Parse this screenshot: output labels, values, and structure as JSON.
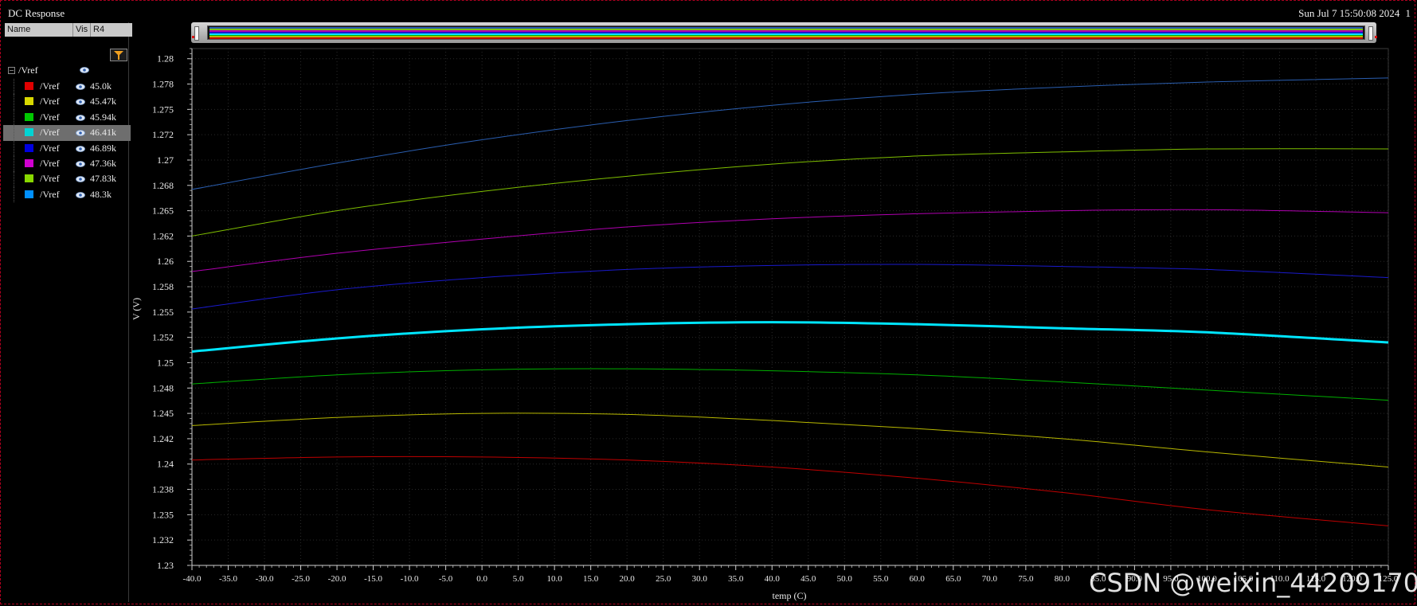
{
  "window": {
    "title": "DC Response",
    "timestamp": "Sun Jul 7 15:50:08 2024",
    "subwindow_index": "1"
  },
  "sidebar": {
    "columns": {
      "name": "Name",
      "vis": "Vis",
      "param": "R4"
    },
    "group": "/Vref",
    "icons": {
      "filter": "filter-icon",
      "visible": "eye-icon",
      "collapse": "collapse-icon"
    },
    "traces": [
      {
        "name": "/Vref",
        "param": "45.0k",
        "color": "#e00000",
        "selected": false
      },
      {
        "name": "/Vref",
        "param": "45.47k",
        "color": "#d8d800",
        "selected": false
      },
      {
        "name": "/Vref",
        "param": "45.94k",
        "color": "#00c800",
        "selected": false
      },
      {
        "name": "/Vref",
        "param": "46.41k",
        "color": "#00d4d4",
        "selected": true
      },
      {
        "name": "/Vref",
        "param": "46.89k",
        "color": "#0000e0",
        "selected": false
      },
      {
        "name": "/Vref",
        "param": "47.36k",
        "color": "#d000d0",
        "selected": false
      },
      {
        "name": "/Vref",
        "param": "47.83k",
        "color": "#88d800",
        "selected": false
      },
      {
        "name": "/Vref",
        "param": "48.3k",
        "color": "#0090ff",
        "selected": false
      }
    ]
  },
  "watermark": "CSDN @weixin_44209170",
  "chart_data": {
    "type": "line",
    "title": "",
    "xlabel": "temp (C)",
    "ylabel": "V (V)",
    "xlim": [
      -40,
      125
    ],
    "ylim": [
      1.23,
      1.281
    ],
    "x_ticks": [
      -40,
      -35,
      -30,
      -25,
      -20,
      -15,
      -10,
      -5,
      0,
      5,
      10,
      15,
      20,
      25,
      30,
      35,
      40,
      45,
      50,
      55,
      60,
      65,
      70,
      75,
      80,
      85,
      90,
      95,
      100,
      105,
      110,
      115,
      120,
      125
    ],
    "x_tick_labels": [
      "-40.0",
      "-35.0",
      "-30.0",
      "-25.0",
      "-20.0",
      "-15.0",
      "-10.0",
      "-5.0",
      "0.0",
      "5.0",
      "10.0",
      "15.0",
      "20.0",
      "25.0",
      "30.0",
      "35.0",
      "40.0",
      "45.0",
      "50.0",
      "55.0",
      "60.0",
      "65.0",
      "70.0",
      "75.0",
      "80.0",
      "85.0",
      "90.0",
      "95.0",
      "100.0",
      "105.0",
      "110.0",
      "115.0",
      "120.0",
      "125.0"
    ],
    "y_ticks": [
      1.23,
      1.2325,
      1.235,
      1.2375,
      1.24,
      1.2425,
      1.245,
      1.2475,
      1.25,
      1.2525,
      1.255,
      1.2575,
      1.26,
      1.2625,
      1.265,
      1.2675,
      1.27,
      1.2725,
      1.275,
      1.2775,
      1.28
    ],
    "y_tick_labels": [
      "1.23",
      "1.232",
      "1.235",
      "1.238",
      "1.24",
      "1.242",
      "1.245",
      "1.248",
      "1.25",
      "1.252",
      "1.255",
      "1.258",
      "1.26",
      "1.262",
      "1.265",
      "1.268",
      "1.27",
      "1.272",
      "1.275",
      "1.278",
      "1.28"
    ],
    "grid": true,
    "x": [
      -40,
      -20,
      0,
      20,
      40,
      60,
      80,
      100,
      125
    ],
    "series": [
      {
        "param": "45.0k",
        "color": "#c00000",
        "values": [
          1.2404,
          1.2407,
          1.2407,
          1.2404,
          1.2397,
          1.2386,
          1.2372,
          1.2355,
          1.2339
        ]
      },
      {
        "param": "45.47k",
        "color": "#b8b800",
        "values": [
          1.2438,
          1.2446,
          1.245,
          1.2449,
          1.2443,
          1.2435,
          1.2425,
          1.2412,
          1.2397
        ]
      },
      {
        "param": "45.94k",
        "color": "#00b000",
        "values": [
          1.2479,
          1.2488,
          1.2493,
          1.2494,
          1.2492,
          1.2488,
          1.2481,
          1.2473,
          1.2463
        ]
      },
      {
        "param": "46.41k",
        "color": "#00e5ff",
        "values": [
          1.2511,
          1.2524,
          1.2533,
          1.2538,
          1.254,
          1.2538,
          1.2534,
          1.253,
          1.252
        ]
      },
      {
        "param": "46.89k",
        "color": "#1a1acc",
        "values": [
          1.2553,
          1.2572,
          1.2584,
          1.2592,
          1.2596,
          1.2597,
          1.2595,
          1.2592,
          1.2584
        ]
      },
      {
        "param": "47.36k",
        "color": "#b000b0",
        "values": [
          1.259,
          1.2608,
          1.2622,
          1.2634,
          1.2642,
          1.2647,
          1.265,
          1.2651,
          1.2648
        ]
      },
      {
        "param": "47.83k",
        "color": "#7fbf00",
        "values": [
          1.2625,
          1.265,
          1.2669,
          1.2684,
          1.2696,
          1.2704,
          1.2708,
          1.2711,
          1.2711
        ]
      },
      {
        "param": "48.3k",
        "color": "#2a5eb0",
        "values": [
          1.2671,
          1.2697,
          1.272,
          1.2739,
          1.2754,
          1.2765,
          1.2772,
          1.2777,
          1.2781
        ]
      }
    ]
  }
}
